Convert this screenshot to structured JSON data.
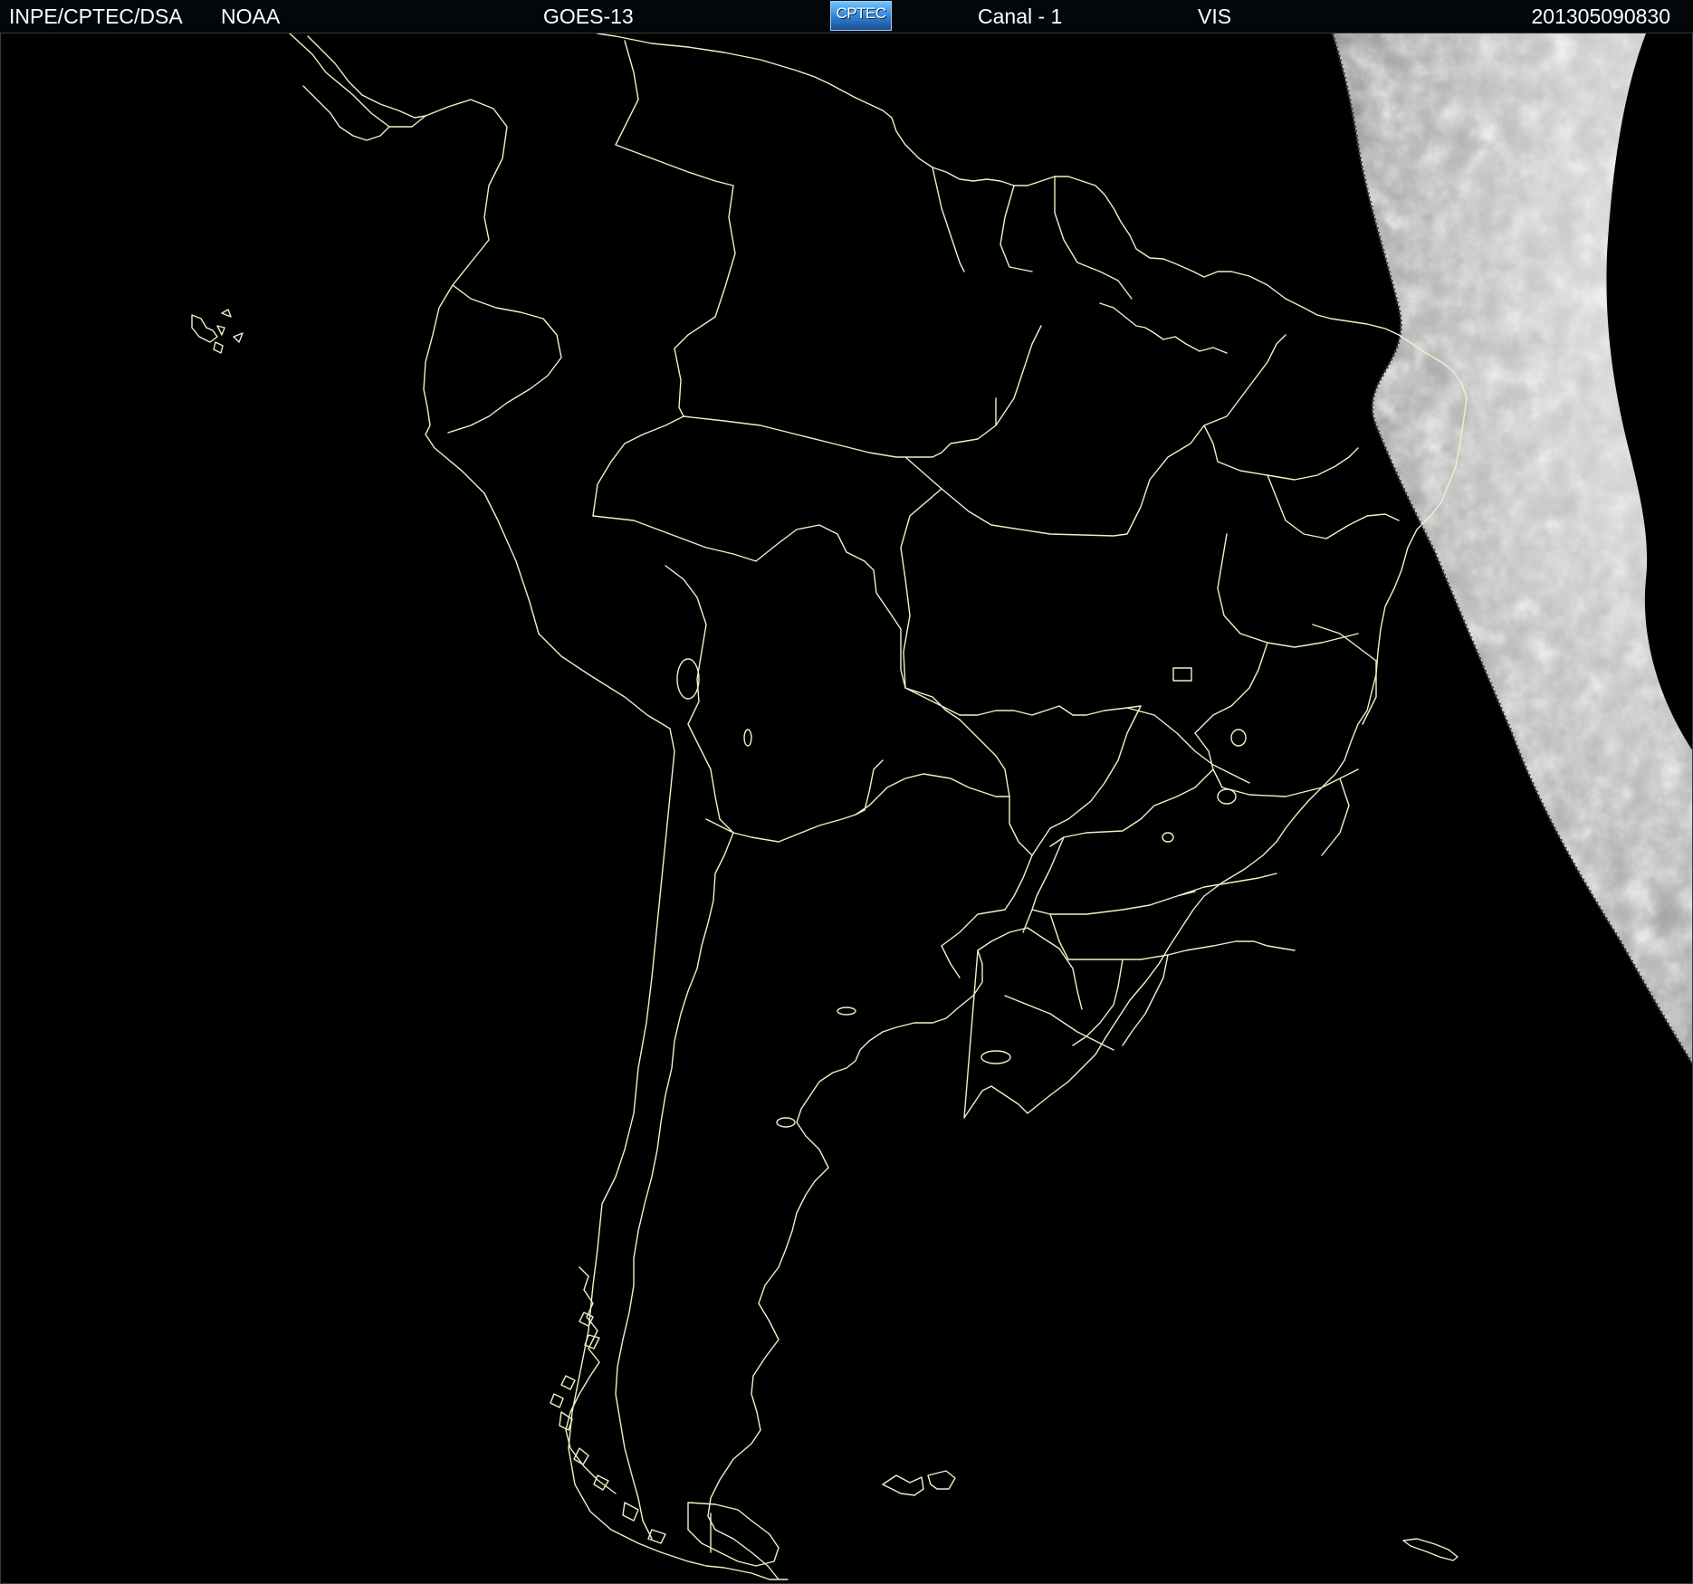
{
  "header": {
    "agency": "INPE/CPTEC/DSA",
    "source": "NOAA",
    "satellite": "GOES-13",
    "logo_text": "CPTEC",
    "channel": "Canal - 1",
    "band": "VIS",
    "timestamp": "201305090830"
  },
  "colors": {
    "background": "#000000",
    "boundary_lines": "#f2f0c8",
    "cloud_light": "#e8e8e8",
    "cloud_dark": "#6a6a6a",
    "header_text": "#ffffff"
  },
  "map": {
    "region": "South America",
    "layers": [
      "coastlines",
      "country-borders",
      "state-borders",
      "satellite-visible-imagery"
    ],
    "illuminated_side": "east (right edge, daylight terminator)"
  }
}
